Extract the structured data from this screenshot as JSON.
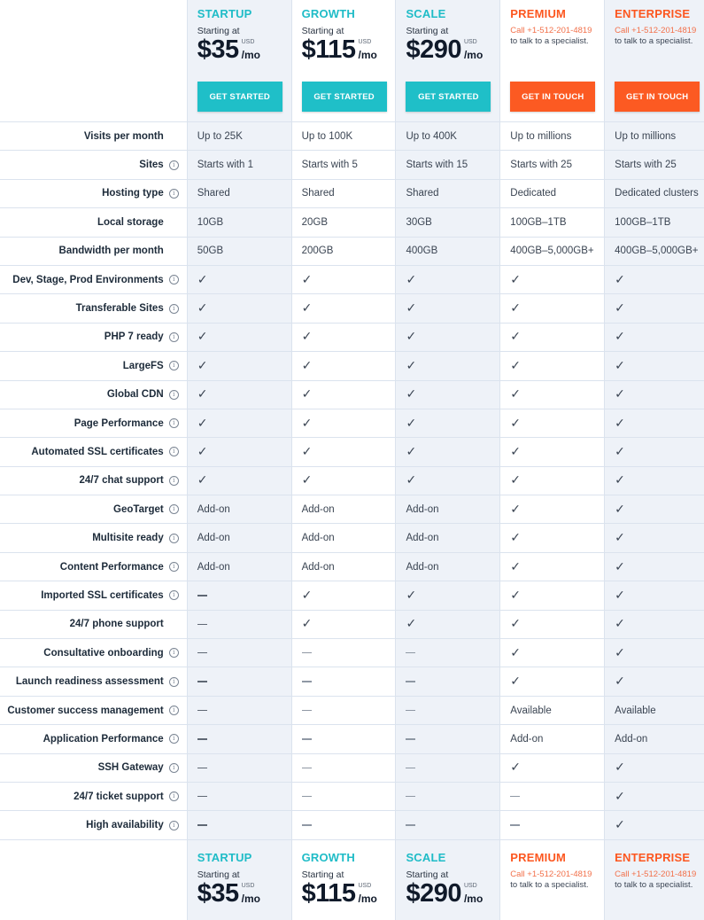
{
  "plans": [
    {
      "name": "STARTUP",
      "accent": "#1fbcc7",
      "type": "self",
      "starting_label": "Starting at",
      "price": "$35",
      "currency": "USD",
      "period": "/mo",
      "button": "GET STARTED",
      "column_bg": "gray"
    },
    {
      "name": "GROWTH",
      "accent": "#1fbcc7",
      "type": "self",
      "starting_label": "Starting at",
      "price": "$115",
      "currency": "USD",
      "period": "/mo",
      "button": "GET STARTED",
      "column_bg": "white"
    },
    {
      "name": "SCALE",
      "accent": "#1fbcc7",
      "type": "self",
      "starting_label": "Starting at",
      "price": "$290",
      "currency": "USD",
      "period": "/mo",
      "button": "GET STARTED",
      "column_bg": "gray"
    },
    {
      "name": "PREMIUM",
      "accent": "#fc5720",
      "type": "contact",
      "call": "Call +1-512-201-4819",
      "talk": "to talk to a specialist.",
      "button": "GET IN TOUCH",
      "column_bg": "white"
    },
    {
      "name": "ENTERPRISE",
      "accent": "#fc5720",
      "type": "contact",
      "call": "Call +1-512-201-4819",
      "talk": "to talk to a specialist.",
      "button": "GET IN TOUCH",
      "column_bg": "gray"
    }
  ],
  "rows": [
    {
      "label": "Visits per month",
      "info": false,
      "values": [
        "Up to 25K",
        "Up to 100K",
        "Up to 400K",
        "Up to millions",
        "Up to millions"
      ]
    },
    {
      "label": "Sites",
      "info": true,
      "values": [
        "Starts with 1",
        "Starts with 5",
        "Starts with 15",
        "Starts with 25",
        "Starts with 25"
      ]
    },
    {
      "label": "Hosting type",
      "info": true,
      "values": [
        "Shared",
        "Shared",
        "Shared",
        "Dedicated",
        "Dedicated clusters"
      ]
    },
    {
      "label": "Local storage",
      "info": false,
      "values": [
        "10GB",
        "20GB",
        "30GB",
        "100GB–1TB",
        "100GB–1TB"
      ]
    },
    {
      "label": "Bandwidth per month",
      "info": false,
      "values": [
        "50GB",
        "200GB",
        "400GB",
        "400GB–5,000GB+",
        "400GB–5,000GB+"
      ]
    },
    {
      "label": "Dev, Stage, Prod Environments",
      "info": true,
      "values": [
        "check",
        "check",
        "check",
        "check",
        "check"
      ]
    },
    {
      "label": "Transferable Sites",
      "info": true,
      "values": [
        "check",
        "check",
        "check",
        "check",
        "check"
      ]
    },
    {
      "label": "PHP 7 ready",
      "info": true,
      "values": [
        "check",
        "check",
        "check",
        "check",
        "check"
      ]
    },
    {
      "label": "LargeFS",
      "info": true,
      "values": [
        "check",
        "check",
        "check",
        "check",
        "check"
      ]
    },
    {
      "label": "Global CDN",
      "info": true,
      "values": [
        "check",
        "check",
        "check",
        "check",
        "check"
      ]
    },
    {
      "label": "Page Performance",
      "info": true,
      "values": [
        "check",
        "check",
        "check",
        "check",
        "check"
      ]
    },
    {
      "label": "Automated SSL certificates",
      "info": true,
      "values": [
        "check",
        "check",
        "check",
        "check",
        "check"
      ]
    },
    {
      "label": "24/7 chat support",
      "info": true,
      "values": [
        "check",
        "check",
        "check",
        "check",
        "check"
      ]
    },
    {
      "label": "GeoTarget",
      "info": true,
      "values": [
        "Add-on",
        "Add-on",
        "Add-on",
        "check",
        "check"
      ]
    },
    {
      "label": "Multisite ready",
      "info": true,
      "values": [
        "Add-on",
        "Add-on",
        "Add-on",
        "check",
        "check"
      ]
    },
    {
      "label": "Content Performance",
      "info": true,
      "values": [
        "Add-on",
        "Add-on",
        "Add-on",
        "check",
        "check"
      ]
    },
    {
      "label": "Imported SSL certificates",
      "info": true,
      "values": [
        "dash",
        "check",
        "check",
        "check",
        "check"
      ]
    },
    {
      "label": "24/7 phone support",
      "info": false,
      "values": [
        "dash",
        "check",
        "check",
        "check",
        "check"
      ]
    },
    {
      "label": "Consultative onboarding",
      "info": true,
      "values": [
        "dash",
        "dash",
        "dash",
        "check",
        "check"
      ]
    },
    {
      "label": "Launch readiness assessment",
      "info": true,
      "values": [
        "dash",
        "dash",
        "dash",
        "check",
        "check"
      ]
    },
    {
      "label": "Customer success management",
      "info": true,
      "values": [
        "dash",
        "dash",
        "dash",
        "Available",
        "Available"
      ]
    },
    {
      "label": "Application Performance",
      "info": true,
      "values": [
        "dash",
        "dash",
        "dash",
        "Add-on",
        "Add-on"
      ]
    },
    {
      "label": "SSH Gateway",
      "info": true,
      "values": [
        "dash",
        "dash",
        "dash",
        "check",
        "check"
      ]
    },
    {
      "label": "24/7 ticket support",
      "info": true,
      "values": [
        "dash",
        "dash",
        "dash",
        "dash",
        "check"
      ]
    },
    {
      "label": "High availability",
      "info": true,
      "values": [
        "dash",
        "dash",
        "dash",
        "dash",
        "check"
      ]
    }
  ],
  "icons": {
    "check": "✓",
    "info": "i",
    "dash": "—"
  }
}
